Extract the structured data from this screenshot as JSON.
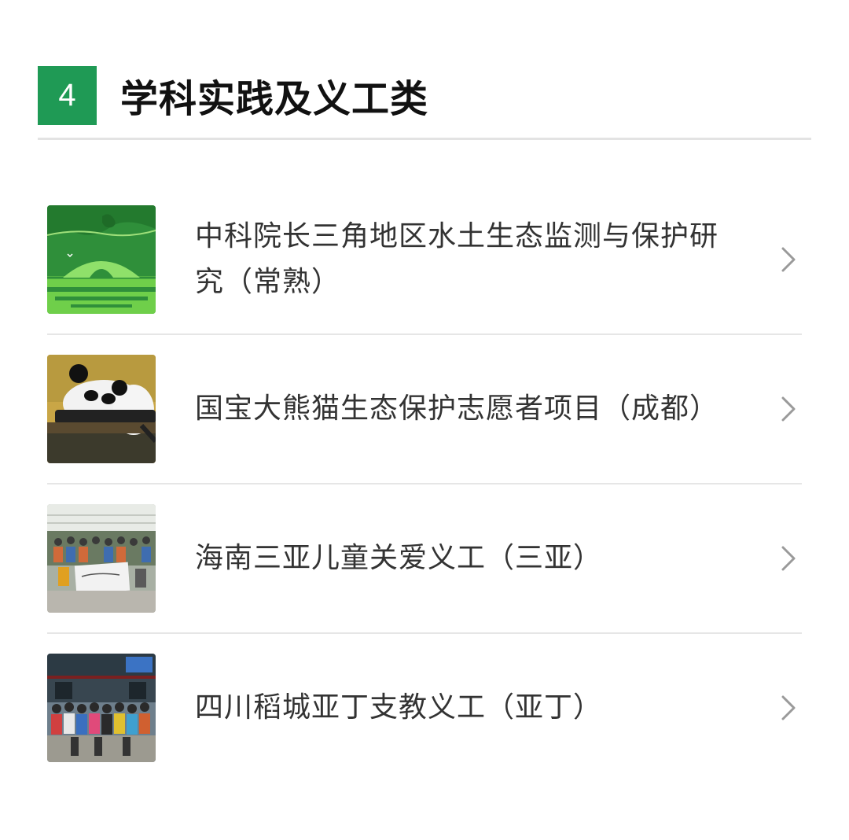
{
  "section": {
    "number": "4",
    "title": "学科实践及义工类"
  },
  "items": [
    {
      "label": "中科院长三角地区水土生态监测与保护研究（常熟）",
      "thumb_icon": "landscape-thumbnail"
    },
    {
      "label": "国宝大熊猫生态保护志愿者项目（成都）",
      "thumb_icon": "panda-thumbnail"
    },
    {
      "label": "海南三亚儿童关爱义工（三亚）",
      "thumb_icon": "group-photo-thumbnail"
    },
    {
      "label": "四川稻城亚丁支教义工（亚丁）",
      "thumb_icon": "group-photo-thumbnail"
    }
  ],
  "colors": {
    "accent": "#1f9a55",
    "divider": "#e6e6e6",
    "chevron": "#9a9a9a"
  }
}
